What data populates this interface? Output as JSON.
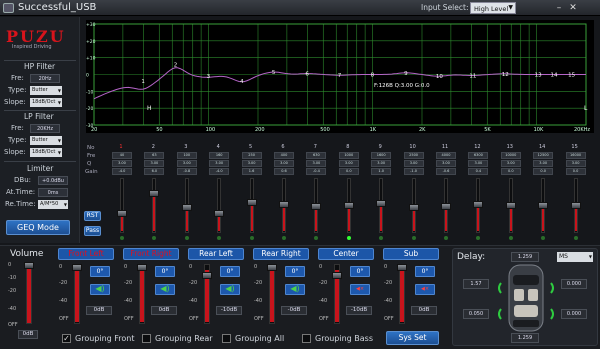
{
  "app": {
    "title": "Successful_USB"
  },
  "input": {
    "label": "Input Select:",
    "value": "High Level"
  },
  "logo": {
    "brand": "PUZU",
    "tagline": "Inspired Driving"
  },
  "hp_filter": {
    "title": "HP Filter",
    "freq_label": "Fre:",
    "freq_value": "20Hz",
    "type_label": "Type:",
    "type_value": "Butter",
    "slope_label": "Slope:",
    "slope_value": "18dB/Oct"
  },
  "lp_filter": {
    "title": "LP Filter",
    "freq_label": "Fre:",
    "freq_value": "20KHz",
    "type_label": "Type:",
    "type_value": "Butter",
    "slope_label": "Slope:",
    "slope_value": "18dB/Oct"
  },
  "limiter": {
    "title": "Limiter",
    "dbu_label": "DBu:",
    "dbu_value": "+0.0dBu",
    "attime_label": "At.Time:",
    "attime_value": "0ms",
    "retime_label": "Re.Time:",
    "retime_value": "A/M*50"
  },
  "geq_mode": "GEQ Mode",
  "graph": {
    "y_labels": [
      "+30",
      "+20",
      "+10",
      "0",
      "-10",
      "-20",
      "-30"
    ],
    "x_labels": [
      "20",
      "50",
      "100",
      "200",
      "500",
      "1K",
      "2K",
      "5K",
      "10K",
      "20KHz"
    ],
    "annotation": "F:126B Q:3.00 G:0.0",
    "h_marker": "H",
    "l_marker": "L",
    "point_labels": [
      "1",
      "2",
      "3",
      "4",
      "5",
      "6",
      "7",
      "8",
      "9",
      "10",
      "11",
      "12",
      "13",
      "14",
      "15"
    ]
  },
  "band_rows": {
    "no": "No",
    "fre": "Fre",
    "q": "Q",
    "gain": "Gain"
  },
  "bands": [
    {
      "no": "1",
      "fre": "40",
      "q": "3.00",
      "gain": "-4.0"
    },
    {
      "no": "2",
      "fre": "63",
      "q": "3.00",
      "gain": "6.0"
    },
    {
      "no": "3",
      "fre": "100",
      "q": "3.00",
      "gain": "-0.8"
    },
    {
      "no": "4",
      "fre": "160",
      "q": "3.00",
      "gain": "-4.0"
    },
    {
      "no": "5",
      "fre": "250",
      "q": "3.00",
      "gain": "1.6"
    },
    {
      "no": "6",
      "fre": "400",
      "q": "3.00",
      "gain": "0.6"
    },
    {
      "no": "7",
      "fre": "630",
      "q": "3.00",
      "gain": "-0.4"
    },
    {
      "no": "8",
      "fre": "1000",
      "q": "3.00",
      "gain": "0.0"
    },
    {
      "no": "9",
      "fre": "1600",
      "q": "3.00",
      "gain": "1.0"
    },
    {
      "no": "10",
      "fre": "2500",
      "q": "3.00",
      "gain": "-1.0"
    },
    {
      "no": "11",
      "fre": "4000",
      "q": "3.00",
      "gain": "-0.6"
    },
    {
      "no": "12",
      "fre": "6300",
      "q": "3.00",
      "gain": "0.4"
    },
    {
      "no": "13",
      "fre": "10000",
      "q": "3.00",
      "gain": "0.0"
    },
    {
      "no": "14",
      "fre": "12500",
      "q": "3.00",
      "gain": "0.0"
    },
    {
      "no": "15",
      "fre": "16000",
      "q": "3.00",
      "gain": "0.0"
    }
  ],
  "band_buttons": {
    "rst": "RST",
    "pass": "Pass"
  },
  "volume": {
    "title": "Volume",
    "scale": [
      "0",
      "-10",
      "-20",
      "-40",
      "OFF"
    ],
    "value": "0dB"
  },
  "channels": [
    {
      "name": "Front Left",
      "active": true,
      "scale": [
        "0",
        "-20",
        "-40",
        "OFF"
      ],
      "phase": "0°",
      "value": "0dB"
    },
    {
      "name": "Front Right",
      "active": true,
      "scale": [
        "0",
        "-20",
        "-40",
        "OFF"
      ],
      "phase": "0°",
      "value": "0dB"
    },
    {
      "name": "Rear Left",
      "active": false,
      "scale": [
        "0",
        "-20",
        "-40",
        "OFF"
      ],
      "phase": "0°",
      "value": "-10dB"
    },
    {
      "name": "Rear Right",
      "active": false,
      "scale": [
        "0",
        "-20",
        "-40",
        "OFF"
      ],
      "phase": "0°",
      "value": "-0dB"
    },
    {
      "name": "Center",
      "active": false,
      "scale": [
        "0",
        "-20",
        "-40",
        "OFF"
      ],
      "phase": "0°",
      "value": "-10dB"
    },
    {
      "name": "Sub",
      "active": false,
      "scale": [
        "0",
        "-20",
        "-40",
        "OFF"
      ],
      "phase": "0°",
      "value": "0dB"
    }
  ],
  "delay": {
    "title": "Delay:",
    "unit": "MS",
    "top": "1.259",
    "bottom": "1.259",
    "left_top": "1.57",
    "left_bottom": "0.050",
    "right_top": "0.000",
    "right_bottom": "0.000"
  },
  "grouping": [
    {
      "label": "Grouping Front",
      "checked": true
    },
    {
      "label": "Grouping Rear",
      "checked": false
    },
    {
      "label": "Grouping All",
      "checked": false
    },
    {
      "label": "Grouping Bass",
      "checked": false
    }
  ],
  "sys_set": "Sys Set",
  "colors": {
    "accent_blue": "#1d58ad",
    "red": "#c8141c",
    "curve": "#b565c8",
    "grid": "#2d8a2d"
  }
}
